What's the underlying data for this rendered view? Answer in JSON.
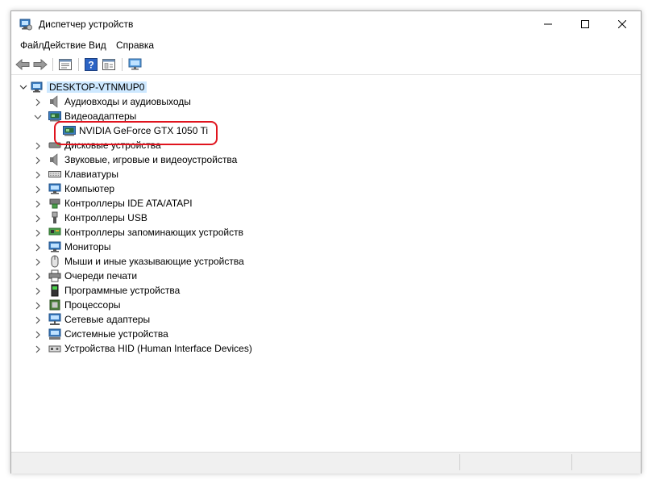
{
  "window": {
    "title": "Диспетчер устройств"
  },
  "menu": [
    {
      "label": "Файл"
    },
    {
      "label": "Действие"
    },
    {
      "label": "Вид"
    },
    {
      "label": "Справка"
    }
  ],
  "tree": {
    "root": "DESKTOP-VTNMUP0",
    "categories": [
      {
        "label": "Аудиовходы и аудиовыходы",
        "icon": "speaker-icon"
      },
      {
        "label": "Видеоадаптеры",
        "icon": "display-adapter-icon",
        "expanded": true,
        "children": [
          {
            "label": "NVIDIA GeForce GTX 1050 Ti",
            "icon": "display-adapter-icon"
          }
        ]
      },
      {
        "label": "Дисковые устройства",
        "icon": "disk-drive-icon"
      },
      {
        "label": "Звуковые, игровые и видеоустройства",
        "icon": "speaker-icon"
      },
      {
        "label": "Клавиатуры",
        "icon": "keyboard-icon"
      },
      {
        "label": "Компьютер",
        "icon": "computer-icon"
      },
      {
        "label": "Контроллеры IDE ATA/ATAPI",
        "icon": "ide-controller-icon"
      },
      {
        "label": "Контроллеры USB",
        "icon": "usb-icon"
      },
      {
        "label": "Контроллеры запоминающих устройств",
        "icon": "storage-controller-icon"
      },
      {
        "label": "Мониторы",
        "icon": "monitor-icon"
      },
      {
        "label": "Мыши и иные указывающие устройства",
        "icon": "mouse-icon"
      },
      {
        "label": "Очереди печати",
        "icon": "printer-icon"
      },
      {
        "label": "Программные устройства",
        "icon": "software-device-icon"
      },
      {
        "label": "Процессоры",
        "icon": "processor-icon"
      },
      {
        "label": "Сетевые адаптеры",
        "icon": "network-adapter-icon"
      },
      {
        "label": "Системные устройства",
        "icon": "system-device-icon"
      },
      {
        "label": "Устройства HID (Human Interface Devices)",
        "icon": "hid-icon"
      }
    ]
  },
  "colors": {
    "selection": "#cde8ff",
    "highlight_border": "#e0141e"
  }
}
